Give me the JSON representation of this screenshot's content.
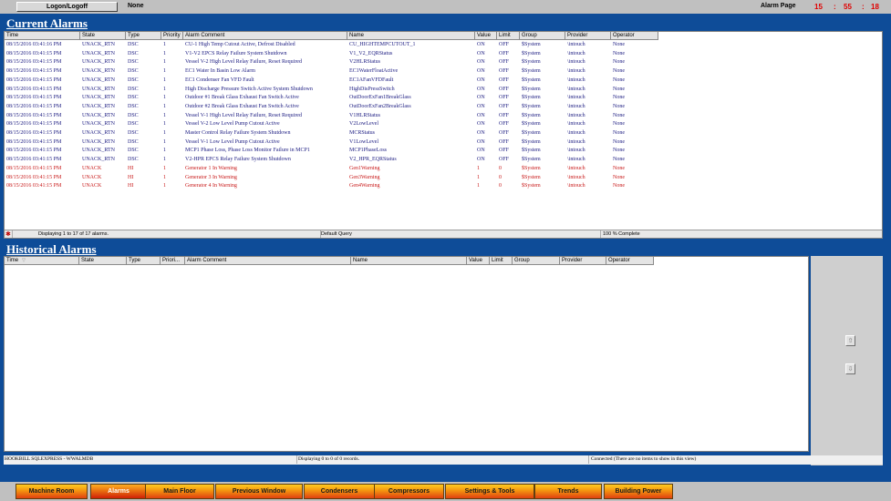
{
  "top": {
    "logon_label": "Logon/Logoff",
    "user": "None",
    "page_label": "Alarm Page",
    "clock": {
      "hh": "15",
      "sep1": ":",
      "mm": "55",
      "sep2": ":",
      "ss": "18"
    }
  },
  "current_alarms": {
    "title": "Current Alarms",
    "columns": [
      "Time",
      "State",
      "Type",
      "Priority",
      "Alarm Comment",
      "Name",
      "Value",
      "Limit",
      "Group",
      "Provider",
      "Operator"
    ],
    "rows": [
      {
        "time": "08/15/2016 03:41:16 PM",
        "state": "UNACK_RTN",
        "type": "DSC",
        "priority": "1",
        "comment": "CU-1 High Temp Cutout Active, Defrost Disabled",
        "name": "CU_HIGHTEMPCUTOUT_1",
        "value": "ON",
        "limit": "OFF",
        "group": "$System",
        "provider": "\\intouch",
        "operator": "None",
        "color": "blue"
      },
      {
        "time": "08/15/2016 03:41:15 PM",
        "state": "UNACK_RTN",
        "type": "DSC",
        "priority": "1",
        "comment": "V1-V2 EPCS Relay Failure System Shutdown",
        "name": "V1_V2_EQRStatus",
        "value": "ON",
        "limit": "OFF",
        "group": "$System",
        "provider": "\\intouch",
        "operator": "None",
        "color": "blue"
      },
      {
        "time": "08/15/2016 03:41:15 PM",
        "state": "UNACK_RTN",
        "type": "DSC",
        "priority": "1",
        "comment": "Vessel V-2 High Level Relay Failure, Reset Required",
        "name": "V2HLRStatus",
        "value": "ON",
        "limit": "OFF",
        "group": "$System",
        "provider": "\\intouch",
        "operator": "None",
        "color": "blue"
      },
      {
        "time": "08/15/2016 03:41:15 PM",
        "state": "UNACK_RTN",
        "type": "DSC",
        "priority": "1",
        "comment": "EC1 Water In Basin Low Alarm",
        "name": "EC1WaterFloatActive",
        "value": "ON",
        "limit": "OFF",
        "group": "$System",
        "provider": "\\intouch",
        "operator": "None",
        "color": "blue"
      },
      {
        "time": "08/15/2016 03:41:15 PM",
        "state": "UNACK_RTN",
        "type": "DSC",
        "priority": "1",
        "comment": "EC1 Condenser Fan VFD Fault",
        "name": "EC1AFanVFDFault",
        "value": "ON",
        "limit": "OFF",
        "group": "$System",
        "provider": "\\intouch",
        "operator": "None",
        "color": "blue"
      },
      {
        "time": "08/15/2016 03:41:15 PM",
        "state": "UNACK_RTN",
        "type": "DSC",
        "priority": "1",
        "comment": "High Discharge Pressure Switch Active System Shutdown",
        "name": "HighDisPressSwitch",
        "value": "ON",
        "limit": "OFF",
        "group": "$System",
        "provider": "\\intouch",
        "operator": "None",
        "color": "blue"
      },
      {
        "time": "08/15/2016 03:41:15 PM",
        "state": "UNACK_RTN",
        "type": "DSC",
        "priority": "1",
        "comment": "Outdoor #1 Break Glass Exhaust Fan Switch Active",
        "name": "OutDoorExFan1BreakGlass",
        "value": "ON",
        "limit": "OFF",
        "group": "$System",
        "provider": "\\intouch",
        "operator": "None",
        "color": "blue"
      },
      {
        "time": "08/15/2016 03:41:15 PM",
        "state": "UNACK_RTN",
        "type": "DSC",
        "priority": "1",
        "comment": "Outdoor #2 Break Glass Exhaust Fan Switch Active",
        "name": "OutDoorExFan2BreakGlass",
        "value": "ON",
        "limit": "OFF",
        "group": "$System",
        "provider": "\\intouch",
        "operator": "None",
        "color": "blue"
      },
      {
        "time": "08/15/2016 03:41:15 PM",
        "state": "UNACK_RTN",
        "type": "DSC",
        "priority": "1",
        "comment": "Vessel V-1 High Level Relay Failure, Reset Required",
        "name": "V1HLRStatus",
        "value": "ON",
        "limit": "OFF",
        "group": "$System",
        "provider": "\\intouch",
        "operator": "None",
        "color": "blue"
      },
      {
        "time": "08/15/2016 03:41:15 PM",
        "state": "UNACK_RTN",
        "type": "DSC",
        "priority": "1",
        "comment": "Vessel V-2 Low Level Pump Cutout Active",
        "name": "V2LowLevel",
        "value": "ON",
        "limit": "OFF",
        "group": "$System",
        "provider": "\\intouch",
        "operator": "None",
        "color": "blue"
      },
      {
        "time": "08/15/2016 03:41:15 PM",
        "state": "UNACK_RTN",
        "type": "DSC",
        "priority": "1",
        "comment": "Master Control Relay Failure System Shutdown",
        "name": "MCRStatus",
        "value": "ON",
        "limit": "OFF",
        "group": "$System",
        "provider": "\\intouch",
        "operator": "None",
        "color": "blue"
      },
      {
        "time": "08/15/2016 03:41:15 PM",
        "state": "UNACK_RTN",
        "type": "DSC",
        "priority": "1",
        "comment": "Vessel V-1 Low Level Pump Cutout Active",
        "name": "V1LowLevel",
        "value": "ON",
        "limit": "OFF",
        "group": "$System",
        "provider": "\\intouch",
        "operator": "None",
        "color": "blue"
      },
      {
        "time": "08/15/2016 03:41:15 PM",
        "state": "UNACK_RTN",
        "type": "DSC",
        "priority": "1",
        "comment": "MCP1 Phase Loss, Phase Loss Monitor Failure in MCP1",
        "name": "MCP1PhaseLoss",
        "value": "ON",
        "limit": "OFF",
        "group": "$System",
        "provider": "\\intouch",
        "operator": "None",
        "color": "blue"
      },
      {
        "time": "08/15/2016 03:41:15 PM",
        "state": "UNACK_RTN",
        "type": "DSC",
        "priority": "1",
        "comment": "V2-HPR EPCS Relay Failure System Shutdown",
        "name": "V2_HPR_EQRStatus",
        "value": "ON",
        "limit": "OFF",
        "group": "$System",
        "provider": "\\intouch",
        "operator": "None",
        "color": "blue"
      },
      {
        "time": "08/15/2016 03:41:15 PM",
        "state": "UNACK",
        "type": "HI",
        "priority": "1",
        "comment": "Generator 1 In Warning",
        "name": "Gen1Warning",
        "value": "1",
        "limit": "0",
        "group": "$System",
        "provider": "\\intouch",
        "operator": "None",
        "color": "red"
      },
      {
        "time": "08/15/2016 03:41:15 PM",
        "state": "UNACK",
        "type": "HI",
        "priority": "1",
        "comment": "Generator 3 In Warning",
        "name": "Gen3Warning",
        "value": "1",
        "limit": "0",
        "group": "$System",
        "provider": "\\intouch",
        "operator": "None",
        "color": "red"
      },
      {
        "time": "08/15/2016 03:41:15 PM",
        "state": "UNACK",
        "type": "HI",
        "priority": "1",
        "comment": "Generator 4 In Warning",
        "name": "Gen4Warning",
        "value": "1",
        "limit": "0",
        "group": "$System",
        "provider": "\\intouch",
        "operator": "None",
        "color": "red"
      }
    ],
    "status": {
      "icon": "error-icon",
      "count_text": "Displaying 1 to 17 of 17 alarms.",
      "query_text": "Default Query",
      "progress_text": "100 % Complete"
    }
  },
  "historical_alarms": {
    "title": "Historical Alarms",
    "columns": [
      "Time",
      "State",
      "Type",
      "Priori...",
      "Alarm Comment",
      "Name",
      "Value",
      "Limit",
      "Group",
      "Provider",
      "Operator"
    ],
    "sort_icon": "sort-down-icon",
    "scroll_up_icon": "arrow-up-icon",
    "scroll_down_icon": "arrow-down-icon",
    "status": {
      "db_text": "HOOKBILL SQLEXPRESS - WWALMDB",
      "count_text": "Displaying 0 to 0 of 0 records.",
      "conn_text": "Connected (There are no items to show in this view)"
    }
  },
  "nav": {
    "buttons": [
      "Machine Room",
      "Alarms",
      "Main Floor",
      "Previous Window",
      "Condensers",
      "Compressors",
      "Settings & Tools",
      "Trends",
      "Building Power"
    ],
    "active": "Alarms"
  }
}
